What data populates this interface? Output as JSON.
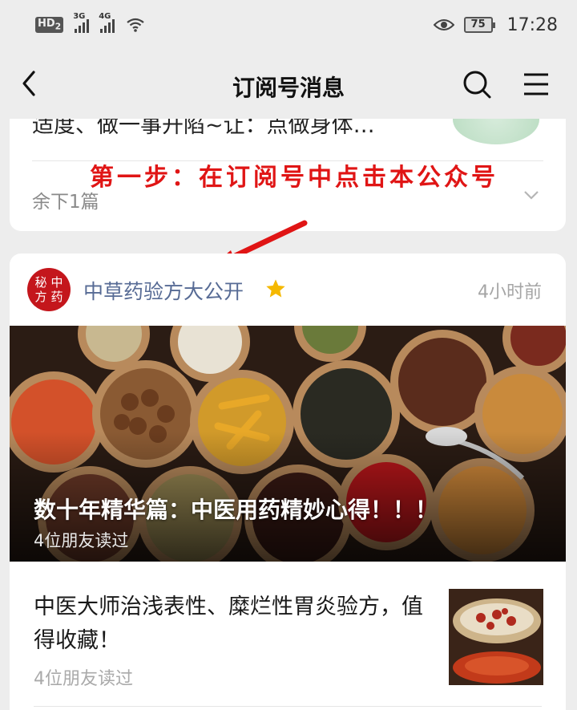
{
  "status_bar": {
    "hd_label": "HD",
    "hd_sub": "2",
    "signal1_label": "3G",
    "signal2_label": "4G",
    "battery": "75",
    "time": "17:28"
  },
  "nav": {
    "title": "订阅号消息"
  },
  "card1": {
    "partial_text": "适度、做一事开陷~让：点做身体…",
    "remaining": "余下1篇"
  },
  "annotation": {
    "step_text": "第一步：在订阅号中点击本公众号",
    "color": "#e01515"
  },
  "card2": {
    "account_logo_chars": [
      "秘",
      "中",
      "方",
      "药"
    ],
    "account_name": "中草药验方大公开",
    "time_ago": "4小时前",
    "cover_article": {
      "title": "数十年精华篇：中医用药精妙心得！！！",
      "reads": "4位朋友读过"
    },
    "article2": {
      "title": "中医大师治浅表性、糜烂性胃炎验方，值得收藏！",
      "reads": "4位朋友读过"
    }
  },
  "colors": {
    "background": "#ededed",
    "account_name": "#576b95",
    "accent_red": "#c4161c"
  }
}
